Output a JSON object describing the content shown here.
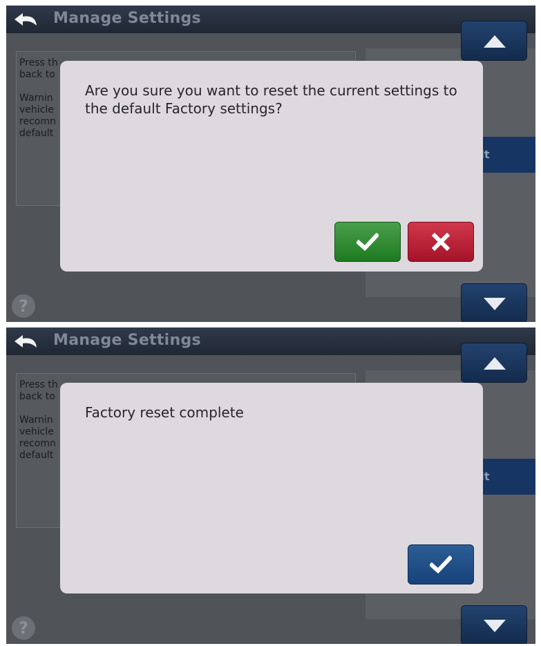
{
  "title": "Manage Settings",
  "content_lines": [
    "Press th",
    "back to",
    "",
    "Warnin",
    "vehicle",
    "recomn",
    "default"
  ],
  "selected_option_label": "ult",
  "help_symbol": "?",
  "screens": [
    {
      "dialog": {
        "message": "Are you sure you want to reset the current settings to the default Factory settings?",
        "buttons": [
          {
            "icon": "check-icon",
            "color": "#2e8a30"
          },
          {
            "icon": "close-icon",
            "color": "#c0203a"
          }
        ]
      }
    },
    {
      "dialog": {
        "message": "Factory reset complete",
        "buttons": [
          {
            "icon": "check-icon",
            "color": "#1f4f86"
          }
        ]
      }
    }
  ],
  "colors": {
    "title_bar": "#252e3b",
    "scroll_button": "#1a365d",
    "selected_option": "#173562",
    "dialog_bg": "#ddd9df"
  }
}
